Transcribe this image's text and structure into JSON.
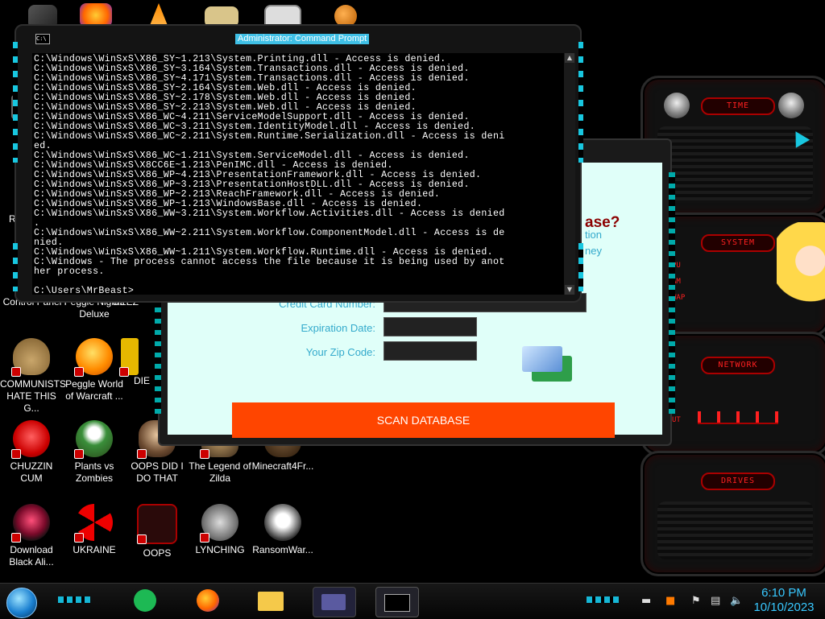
{
  "desktop_icons": [
    {
      "label": "Control Panel"
    },
    {
      "label": "Peggle Nights Deluxe"
    },
    {
      "label": "DEEZ"
    },
    {
      "label": "COMMUNISTS HATE THIS G..."
    },
    {
      "label": "Peggle World of Warcraft ..."
    },
    {
      "label": "DIE"
    },
    {
      "label": "CHUZZIN CUM"
    },
    {
      "label": "Plants vs Zombies"
    },
    {
      "label": "OOPS DID I DO THAT"
    },
    {
      "label": "The Legend of Zilda"
    },
    {
      "label": "Minecraft4Fr..."
    },
    {
      "label": "Download Black Ali..."
    },
    {
      "label": "UKRAINE"
    },
    {
      "label": "OOPS"
    },
    {
      "label": "LYNCHING"
    },
    {
      "label": "RansomWar..."
    }
  ],
  "left_edge_fragments": {
    "n": "N",
    "re": "Re"
  },
  "cmd": {
    "title": "Administrator: Command Prompt",
    "icon_text": "C:\\",
    "output": "C:\\Windows\\WinSxS\\X86_SY~1.213\\System.Printing.dll - Access is denied.\nC:\\Windows\\WinSxS\\X86_SY~3.164\\System.Transactions.dll - Access is denied.\nC:\\Windows\\WinSxS\\X86_SY~4.171\\System.Transactions.dll - Access is denied.\nC:\\Windows\\WinSxS\\X86_SY~2.164\\System.Web.dll - Access is denied.\nC:\\Windows\\WinSxS\\X86_SY~2.178\\System.Web.dll - Access is denied.\nC:\\Windows\\WinSxS\\X86_SY~2.213\\System.Web.dll - Access is denied.\nC:\\Windows\\WinSxS\\X86_WC~4.211\\ServiceModelSupport.dll - Access is denied.\nC:\\Windows\\WinSxS\\X86_WC~3.211\\System.IdentityModel.dll - Access is denied.\nC:\\Windows\\WinSxS\\X86_WC~2.211\\System.Runtime.Serialization.dll - Access is deni\ned.\nC:\\Windows\\WinSxS\\X86_WC~1.211\\System.ServiceModel.dll - Access is denied.\nC:\\Windows\\WinSxS\\X8CC6E~1.213\\PenIMC.dll - Access is denied.\nC:\\Windows\\WinSxS\\X86_WP~4.213\\PresentationFramework.dll - Access is denied.\nC:\\Windows\\WinSxS\\X86_WP~3.213\\PresentationHostDLL.dll - Access is denied.\nC:\\Windows\\WinSxS\\X86_WP~2.213\\ReachFramework.dll - Access is denied.\nC:\\Windows\\WinSxS\\X86_WP~1.213\\WindowsBase.dll - Access is denied.\nC:\\Windows\\WinSxS\\X86_WW~3.211\\System.Workflow.Activities.dll - Access is denied\n.\nC:\\Windows\\WinSxS\\X86_WW~2.211\\System.Workflow.ComponentModel.dll - Access is de\nnied.\nC:\\Windows\\WinSxS\\X86_WW~1.211\\System.Workflow.Runtime.dll - Access is denied.\nC:\\Windows - The process cannot access the file because it is being used by anot\nher process.\n\nC:\\Users\\MrBeast>"
  },
  "scan": {
    "heading_fragment": "ase?",
    "blue_fragment_1": "tion",
    "blue_fragment_2": "ney",
    "label_card_number": "Credit Card Number:",
    "label_expiration": "Expiration Date:",
    "label_zip": "Your Zip Code:",
    "button_label": "SCAN DATABASE"
  },
  "gadgets": {
    "time_title": "TIME",
    "system_title": "SYSTEM",
    "system_lines": [
      "PU",
      "AM",
      "WAP"
    ],
    "network_title": "NETWORK",
    "network_fragment": "UT",
    "drives_title": "DRIVES"
  },
  "taskbar": {
    "clock_time": "6:10 PM",
    "clock_date": "10/10/2023"
  },
  "colors": {
    "accent_cyan": "#18c7e0",
    "alien_red": "#ff2020",
    "scan_button": "#ff4500",
    "scan_background": "#e0fff9"
  }
}
